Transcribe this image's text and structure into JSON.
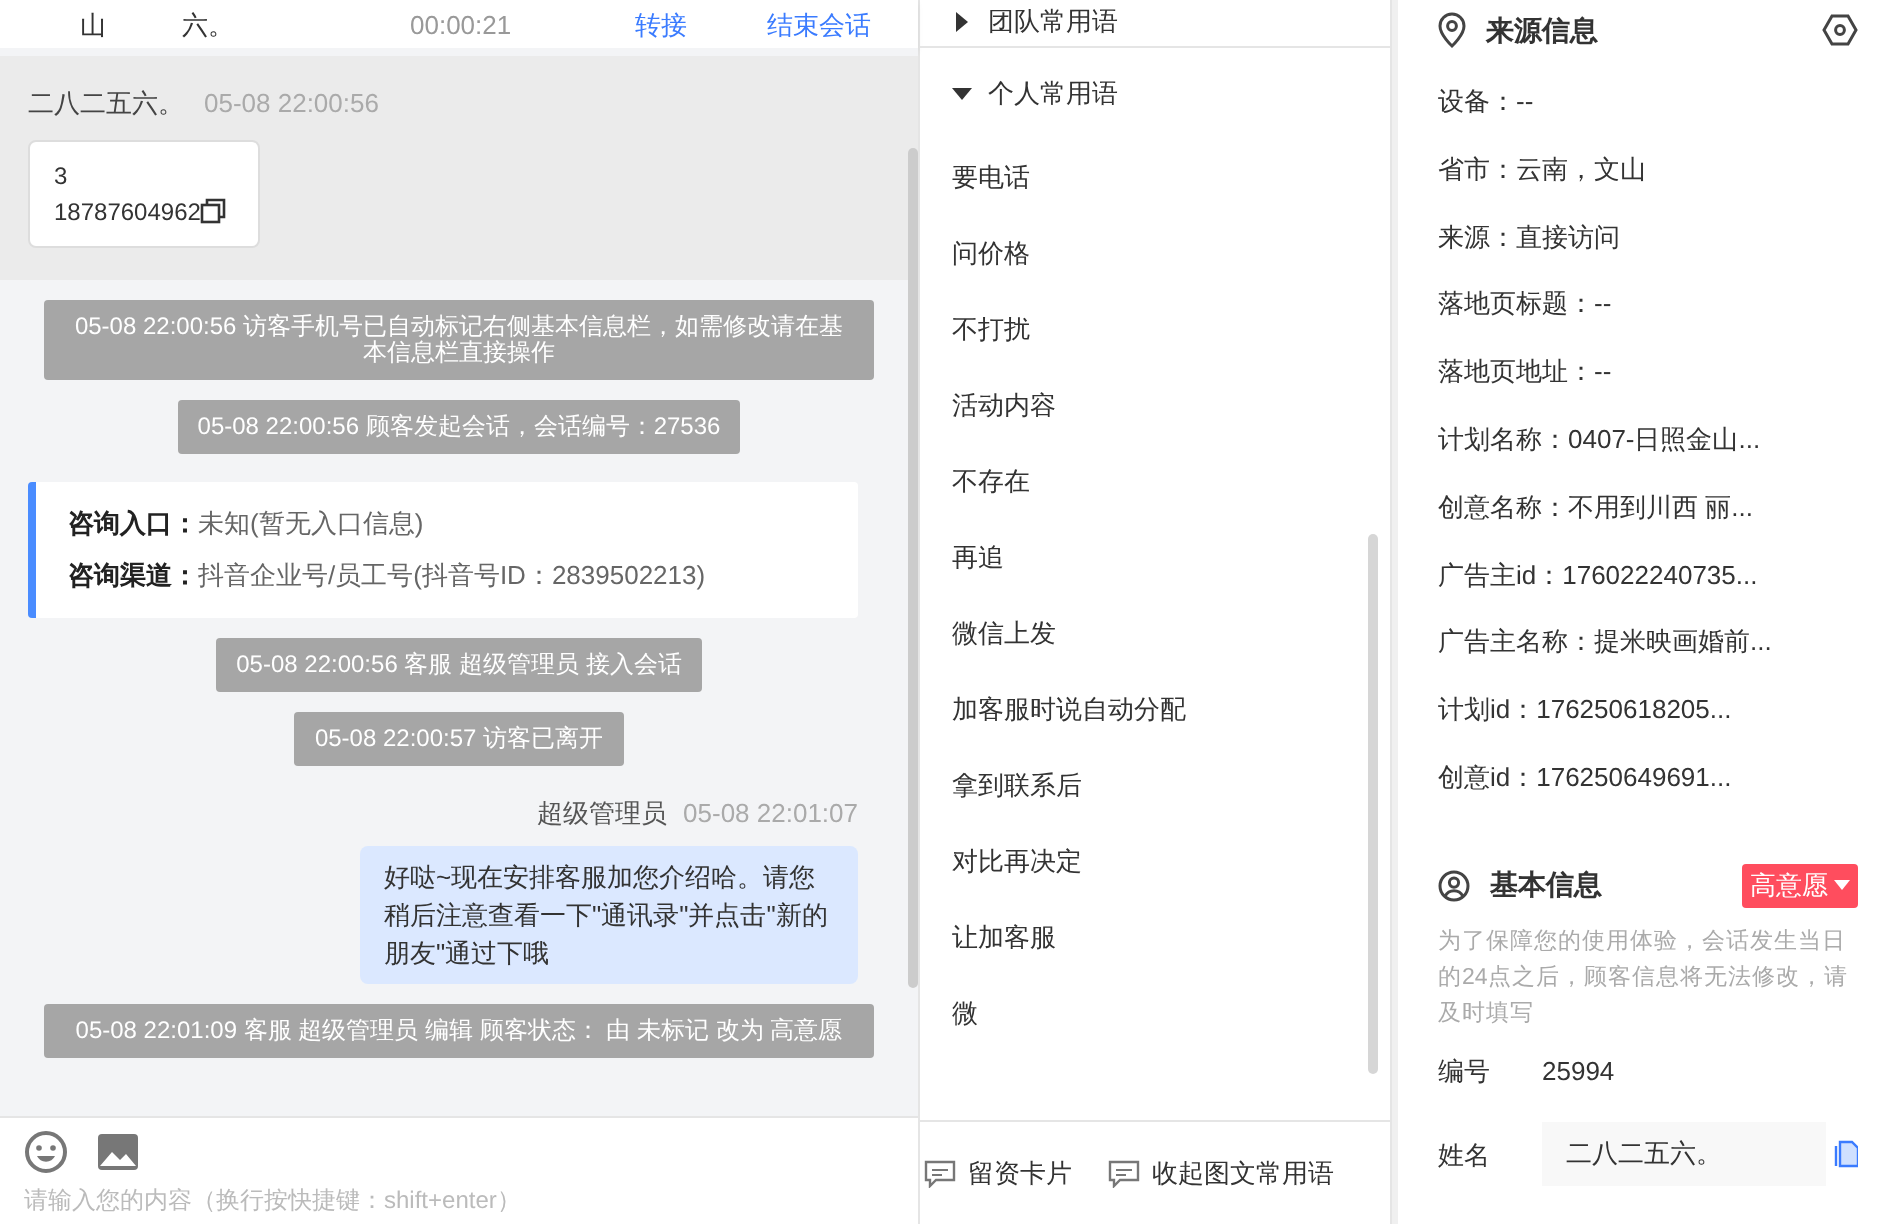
{
  "header": {
    "items": [
      "山",
      "六。"
    ],
    "timer": "00:00:21",
    "actions": [
      "转接",
      "结束会话"
    ]
  },
  "chat": {
    "messages": [
      {
        "kind": "visitor_card",
        "sender": "二八二五六。",
        "time": "05-08 22:00:56",
        "lines": [
          "3",
          "18787604962"
        ]
      },
      {
        "kind": "system",
        "text": "05-08 22:00:56 访客手机号已自动标记右侧基本信息栏，如需修改请在基本信息栏直接操作"
      },
      {
        "kind": "system",
        "text": "05-08 22:00:56 顾客发起会话，会话编号：27536"
      },
      {
        "kind": "source",
        "rows": [
          {
            "label": "咨询入口：",
            "value": "未知(暂无入口信息)"
          },
          {
            "label": "咨询渠道：",
            "value": "抖音企业号/员工号(抖音号ID：2839502213)"
          }
        ]
      },
      {
        "kind": "system",
        "text": "05-08 22:00:56 客服 超级管理员 接入会话"
      },
      {
        "kind": "system",
        "text": "05-08 22:00:57 访客已离开"
      },
      {
        "kind": "agent",
        "sender": "超级管理员",
        "time": "05-08 22:01:07",
        "text": "好哒~现在安排客服加您介绍哈。请您稍后注意查看一下\"通讯录\"并点击\"新的朋友\"通过下哦"
      },
      {
        "kind": "system",
        "text": "05-08 22:01:09 客服 超级管理员 编辑 顾客状态： 由 未标记 改为 高意愿"
      }
    ]
  },
  "composer": {
    "placeholder": "请输入您的内容（换行按快捷键：shift+enter）"
  },
  "phrases": {
    "groups": [
      {
        "title": "团队常用语",
        "expanded": false
      },
      {
        "title": "个人常用语",
        "expanded": true,
        "items": [
          "要电话",
          "问价格",
          "不打扰",
          "活动内容",
          "不存在",
          "再追",
          "微信上发",
          "加客服时说自动分配",
          "拿到联系后",
          "对比再决定",
          "让加客服",
          "微"
        ]
      }
    ],
    "buttons": [
      "留资卡片",
      "收起图文常用语"
    ]
  },
  "info": {
    "source": {
      "title": "来源信息",
      "fields": [
        "设备：--",
        "省市：云南，文山",
        "来源：直接访问",
        "落地页标题：--",
        "落地页地址：--",
        "计划名称：0407-日照金山...",
        "创意名称：不用到川西 丽...",
        "广告主id：176022240735...",
        "广告主名称：提米映画婚前...",
        "计划id：176250618205...",
        "创意id：176250649691..."
      ]
    },
    "basic": {
      "title": "基本信息",
      "tag": "高意愿",
      "notice": "为了保障您的使用体验，会话发生当日的24点之后，顾客信息将无法修改，请及时填写",
      "fields": [
        {
          "kind": "text",
          "label": "编号",
          "value": "25994"
        },
        {
          "kind": "input",
          "label": "姓名",
          "value": "二八二五六。"
        }
      ]
    }
  }
}
